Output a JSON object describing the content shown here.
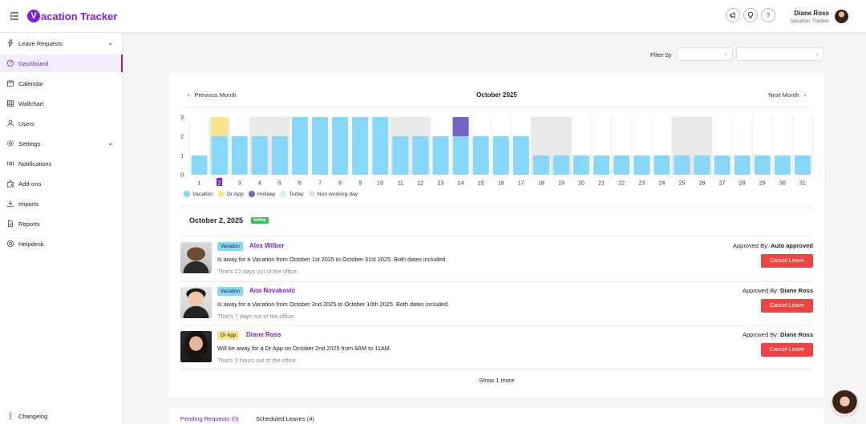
{
  "app": {
    "logo_letter": "V",
    "logo_text": "acation Tracker"
  },
  "header": {
    "user_name": "Diane Ross",
    "user_org": "Vacation Tracker",
    "help_glyph": "?"
  },
  "sidebar": {
    "items": [
      {
        "label": "Leave Requests",
        "icon": "leave-requests-icon",
        "has_chevron": true
      },
      {
        "label": "Dashboard",
        "icon": "dashboard-icon",
        "active": true
      },
      {
        "label": "Calendar",
        "icon": "calendar-icon"
      },
      {
        "label": "Wallchart",
        "icon": "wallchart-icon"
      },
      {
        "label": "Users",
        "icon": "user-icon"
      },
      {
        "label": "Settings",
        "icon": "settings-icon",
        "has_chevron": true
      },
      {
        "label": "Notifications",
        "icon": "notifications-icon"
      },
      {
        "label": "Add-ons",
        "icon": "add-ons-icon"
      },
      {
        "label": "Imports",
        "icon": "imports-icon"
      },
      {
        "label": "Reports",
        "icon": "reports-icon"
      },
      {
        "label": "Helpdesk",
        "icon": "helpdesk-icon"
      }
    ],
    "changelog": "Changelog"
  },
  "filter": {
    "label": "Filter by"
  },
  "calendar": {
    "prev": "Previous Month",
    "title": "October 2025",
    "next": "Next Month"
  },
  "chart_data": {
    "type": "bar",
    "x": [
      1,
      2,
      3,
      4,
      5,
      6,
      7,
      8,
      9,
      10,
      11,
      12,
      13,
      14,
      15,
      16,
      17,
      18,
      19,
      20,
      21,
      22,
      23,
      24,
      25,
      26,
      27,
      28,
      29,
      30,
      31
    ],
    "selected_day": 2,
    "ylim": [
      0,
      3
    ],
    "yticks": [
      0,
      1,
      2,
      3
    ],
    "series": [
      {
        "name": "Vacation",
        "color": "#87d7fb",
        "values": [
          1,
          2,
          2,
          2,
          2,
          3,
          3,
          3,
          3,
          3,
          2,
          2,
          2,
          2,
          2,
          2,
          2,
          1,
          1,
          1,
          1,
          1,
          1,
          1,
          1,
          1,
          1,
          1,
          1,
          1,
          1
        ]
      },
      {
        "name": "Dr App",
        "color": "#fbe38a",
        "values": [
          0,
          1,
          0,
          0,
          0,
          0,
          0,
          0,
          0,
          0,
          0,
          0,
          0,
          0,
          0,
          0,
          0,
          0,
          0,
          0,
          0,
          0,
          0,
          0,
          0,
          0,
          0,
          0,
          0,
          0,
          0
        ]
      },
      {
        "name": "Holiday",
        "color": "#7462c4",
        "values": [
          0,
          0,
          0,
          0,
          0,
          0,
          0,
          0,
          0,
          0,
          0,
          0,
          0,
          1,
          0,
          0,
          0,
          0,
          0,
          0,
          0,
          0,
          0,
          0,
          0,
          0,
          0,
          0,
          0,
          0,
          0
        ]
      }
    ],
    "today_day": 2,
    "non_working_days": [
      4,
      5,
      11,
      12,
      18,
      19,
      25,
      26
    ],
    "legend": [
      {
        "label": "Vacation",
        "color": "#87d7fb"
      },
      {
        "label": "Dr App",
        "color": "#fbe38a"
      },
      {
        "label": "Holiday",
        "color": "#7462c4"
      },
      {
        "label": "Today",
        "color": "#d8f2dc"
      },
      {
        "label": "Non working day",
        "color": "#e2e2e2"
      }
    ],
    "colors": {
      "today_bg": "#d8f2dc",
      "non_working_bg": "#e9e9e9",
      "selected": "#7b1fe0"
    }
  },
  "day_section": {
    "date": "October 2, 2025",
    "today": "today"
  },
  "leaves": [
    {
      "type": "Vacation",
      "type_color": "#87d7fb",
      "name": "Alex Wilber",
      "desc": "Is away for a Vacation from October 1st 2025 to October 31st 2025. Both dates included.",
      "sub": "That's 22 days out of the office.",
      "approved_label": "Approved By:",
      "approved_by": "Auto approved",
      "cancel": "Cancel Leave"
    },
    {
      "type": "Vacation",
      "type_color": "#87d7fb",
      "name": "Ana Novakovic",
      "desc": "Is away for a Vacation from October 2nd 2025 to October 10th 2025. Both dates included.",
      "sub": "That's 7 days out of the office.",
      "approved_label": "Approved By:",
      "approved_by": "Diane Ross",
      "cancel": "Cancel Leave"
    },
    {
      "type": "Dr App",
      "type_color": "#fbe38a",
      "name": "Diane Ross",
      "desc": "Will be away for a Dr App on October 2nd 2025 from 8AM to 11AM.",
      "sub": "That's 3 hours out of the office.",
      "approved_label": "Approved By:",
      "approved_by": "Diane Ross",
      "cancel": "Cancel Leave"
    }
  ],
  "show_more": "Show 1 more",
  "tabs": {
    "pending": "Pending Requests (0)",
    "scheduled": "Scheduled Leaves (4)"
  }
}
